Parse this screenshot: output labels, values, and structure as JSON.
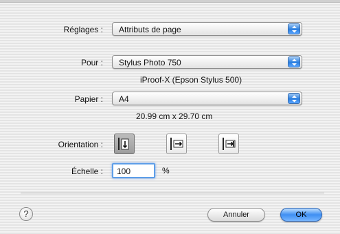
{
  "settings": {
    "label": "Réglages",
    "value": "Attributs de page"
  },
  "format_for": {
    "label": "Pour",
    "value": "Stylus Photo 750",
    "detail": "iProof-X (Epson Stylus 500)"
  },
  "paper": {
    "label": "Papier",
    "value": "A4",
    "detail": "20.99 cm x 29.70 cm"
  },
  "orientation": {
    "label": "Orientation",
    "options": [
      {
        "name": "portrait",
        "selected": true
      },
      {
        "name": "landscape-left",
        "selected": false
      },
      {
        "name": "landscape-right",
        "selected": false
      }
    ]
  },
  "scale": {
    "label": "Échelle",
    "value": "100",
    "unit": "%"
  },
  "buttons": {
    "help": "?",
    "cancel": "Annuler",
    "ok": "OK"
  },
  "colors": {
    "accent": "#3f8ff2",
    "focus_ring": "#5d9ee8"
  },
  "icons": [
    "popup-arrows-icon",
    "portrait-orientation-icon",
    "landscape-left-icon",
    "landscape-right-icon",
    "help-icon"
  ]
}
